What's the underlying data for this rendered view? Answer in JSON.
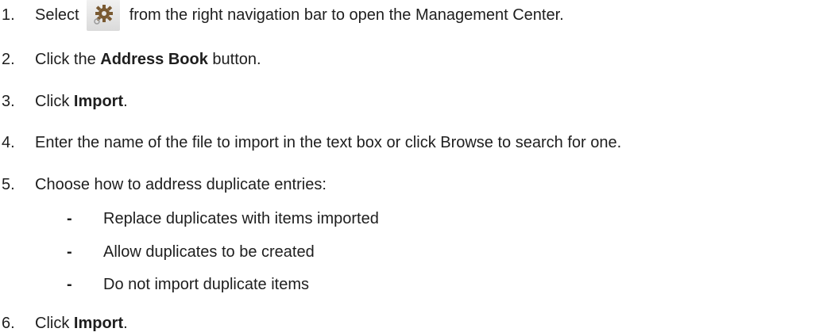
{
  "steps": [
    {
      "number": "1.",
      "parts": [
        "Select",
        "from the right navigation bar to open the Management Center."
      ],
      "icon": "gear-icon"
    },
    {
      "number": "2.",
      "before": "Click the ",
      "bold": "Address Book",
      "after": " button."
    },
    {
      "number": "3.",
      "before": "Click ",
      "bold": "Import",
      "after": "."
    },
    {
      "number": "4.",
      "text": "Enter the name of the file to import in the text box or click Browse to search for one."
    },
    {
      "number": "5.",
      "text": "Choose how to address duplicate entries:",
      "options": [
        {
          "bullet": "-",
          "text": "Replace duplicates with items imported"
        },
        {
          "bullet": "-",
          "text": "Allow duplicates to be created"
        },
        {
          "bullet": "-",
          "text": "Do not import duplicate items"
        }
      ]
    },
    {
      "number": "6.",
      "before": "Click ",
      "bold": "Import",
      "after": "."
    }
  ]
}
